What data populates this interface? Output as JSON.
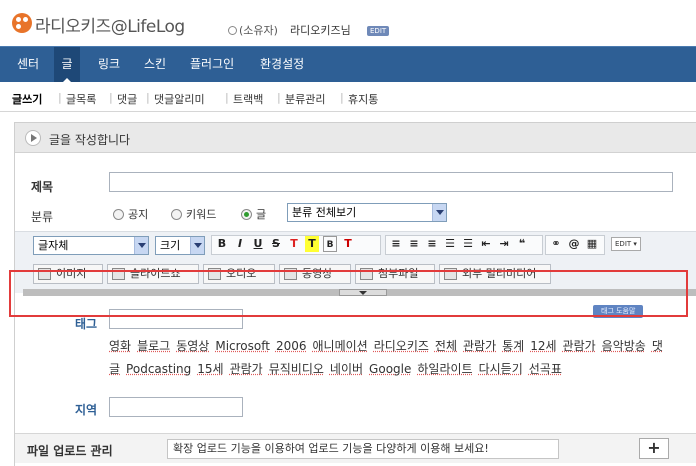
{
  "header": {
    "logo_text": "라디오키즈@LifeLog",
    "owner_label": "(소유자)",
    "nickname": "라디오키즈님",
    "edit_badge": "EDIT"
  },
  "nav": {
    "items": [
      "센터",
      "글",
      "링크",
      "스킨",
      "플러그인",
      "환경설정"
    ],
    "active": "글"
  },
  "subnav": {
    "items": [
      "글쓰기",
      "글목록",
      "댓글",
      "댓글알리미",
      "트랙백",
      "분류관리",
      "휴지통"
    ],
    "active": "글쓰기"
  },
  "editor": {
    "heading": "글을 작성합니다",
    "title_label": "제목",
    "title_value": "",
    "category_label": "분류",
    "post_types": [
      "공지",
      "키워드",
      "글"
    ],
    "selected_post_type": "글",
    "category_select": "분류 전체보기",
    "font_select": "글자체",
    "size_select": "크기",
    "format_buttons": [
      "B",
      "I",
      "U",
      "S",
      "T",
      "T",
      "B",
      "T"
    ],
    "edit_small": "EDIT",
    "media_buttons": [
      "이미지",
      "슬라이드쇼",
      "오디오",
      "동영상",
      "첨부파일",
      "외부 멀티미디어"
    ],
    "tag_help": "태그 도움말",
    "tag_label": "태그",
    "tags": [
      "영화",
      "블로그",
      "동영상",
      "Microsoft",
      "2006",
      "애니메이션",
      "라디오키즈",
      "전체",
      "관람가",
      "통계",
      "12세",
      "관람가",
      "음악방송",
      "댓글",
      "Podcasting",
      "15세",
      "관람가",
      "뮤직비디오",
      "네이버",
      "Google",
      "하일라이트",
      "다시듣기",
      "선곡표"
    ],
    "location_label": "지역",
    "location_value": "",
    "upload_label": "파일 업로드 관리",
    "upload_info": "확장 업로드 기능을 이용하여 업로드 기능을 다양하게 이용해 보세요!",
    "plus_symbol": "+"
  },
  "colors": {
    "nav_bg": "#2e5f95",
    "highlight_border": "#e23b3b",
    "logo_orange": "#e8742a"
  }
}
